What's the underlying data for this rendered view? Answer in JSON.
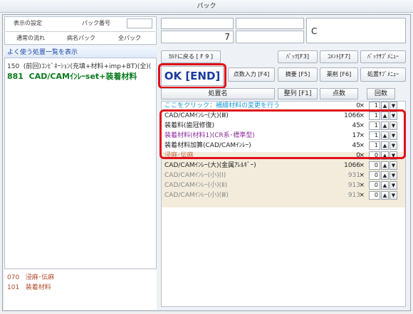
{
  "window": {
    "title": "パック"
  },
  "left_top": {
    "display_settings": "表示の設定",
    "pack_number_label": "パック番号",
    "pack_number_value": "",
    "normal_flow": "通常の流れ",
    "disease_pack": "病名パック",
    "all_pack": "全パック"
  },
  "right_top": {
    "field_number": "7",
    "field_letter": "C"
  },
  "common_procedures": {
    "header": "よく使う処置一覧を表示",
    "items": [
      {
        "code": "150",
        "label": "(前回)ｺﾝﾋﾞﾈｰｼｮﾝ(充填+材料+imp+BT)(全)("
      },
      {
        "code": "881",
        "label": "CAD/CAMｲﾝﾚｰset+装着材料"
      }
    ],
    "bottom_items": [
      {
        "code": "070",
        "label": "浸麻･伝麻"
      },
      {
        "code": "101",
        "label": "装着材料"
      }
    ]
  },
  "toolbar": {
    "back_to_chart": "ｶﾙﾃに戻る [ F 9 ]",
    "pack_f3": "ﾊﾟｯｸ[F3]",
    "comment_f7": "ｺﾒﾝﾄ[F7]",
    "pack_submenu": "ﾊﾟｯｸｻﾌﾞﾒﾆｭｰ",
    "ok_end": "OK [END]",
    "points_input_f4": "点数入力 [F4]",
    "summary_f5": "摘要 [F5]",
    "drug_f6": "薬剤 [F6]",
    "treatment_submenu": "処置ｻﾌﾞﾒﾆｭｰ"
  },
  "table": {
    "columns": {
      "name": "処置名",
      "sort": "整列 [F1]",
      "points": "点数",
      "count": "回数"
    },
    "rows": [
      {
        "name": "ここをクリック：補綴材料の変更を行う",
        "points": "0",
        "count": "1",
        "style": "link"
      },
      {
        "name": "CAD/CAMｲﾝﾚｰ(大)(Ⅲ)",
        "points": "1066",
        "count": "1",
        "style": "normal"
      },
      {
        "name": "装着料(歯冠修復)",
        "points": "45",
        "count": "1",
        "style": "normal"
      },
      {
        "name": "装着材料(材料1)(CR系･標準型)",
        "points": "17",
        "count": "1",
        "style": "purple"
      },
      {
        "name": "装着材料加算(CAD/CAMｲﾝﾚｰ)",
        "points": "45",
        "count": "1",
        "style": "normal"
      },
      {
        "name": "浸麻･伝麻",
        "points": "0",
        "count": "0",
        "style": "faint"
      },
      {
        "name": "CAD/CAMｲﾝﾚｰ(大)(金属ｱﾚﾙｷﾞｰ)",
        "points": "1066",
        "count": "0",
        "style": "normal"
      },
      {
        "name": "CAD/CAMｲﾝﾚｰ(小)(Ⅰ)",
        "points": "931",
        "count": "0",
        "style": "gray"
      },
      {
        "name": "CAD/CAMｲﾝﾚｰ(小)(Ⅱ)",
        "points": "913",
        "count": "0",
        "style": "gray"
      },
      {
        "name": "CAD/CAMｲﾝﾚｰ(小)(Ⅲ)",
        "points": "913",
        "count": "0",
        "style": "gray"
      }
    ],
    "times_symbol": "×",
    "up_arrow": "▲",
    "down_arrow": "▼"
  },
  "colors": {
    "highlight_red": "#e0101a",
    "link_blue": "#1a9ad6",
    "purple": "#8a2a9a",
    "ok_blue": "#1a3a9e",
    "beige": "#f3ecdc"
  }
}
